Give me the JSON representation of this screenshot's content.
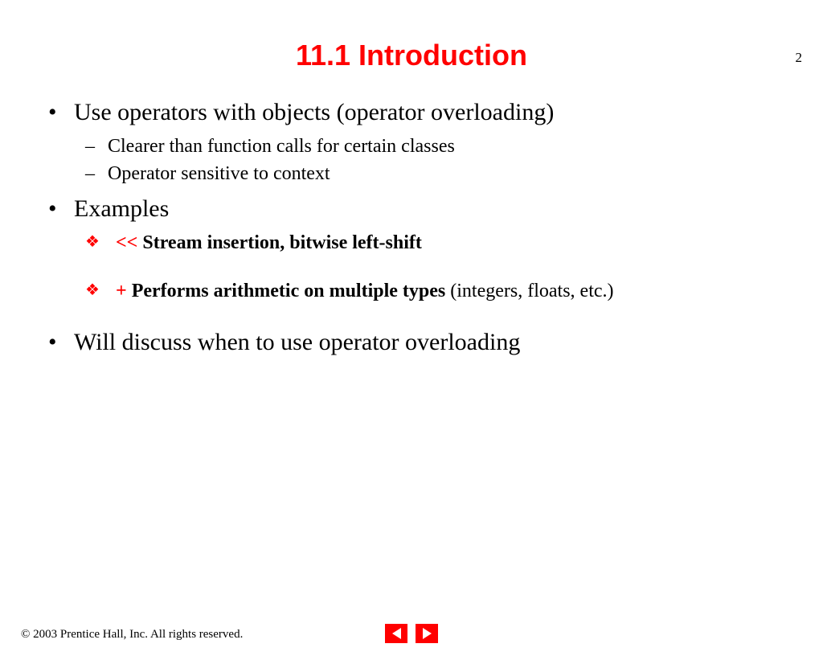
{
  "pageNumber": "2",
  "title": "11.1 Introduction",
  "bullets": {
    "b1": "Use operators with objects (operator overloading)",
    "b1_sub1": "Clearer than function calls for certain classes",
    "b1_sub2": "Operator sensitive to context",
    "b2": "Examples",
    "b2_ex1_op": "<<",
    "b2_ex1_text": "  Stream insertion,  bitwise left-shift",
    "b2_ex2_op": "+",
    "b2_ex2_bold": "  Performs arithmetic on multiple types",
    "b2_ex2_rest": " (integers, floats, etc.)",
    "b3": "Will discuss when to use operator overloading"
  },
  "footer": "© 2003 Prentice Hall, Inc.  All rights reserved."
}
